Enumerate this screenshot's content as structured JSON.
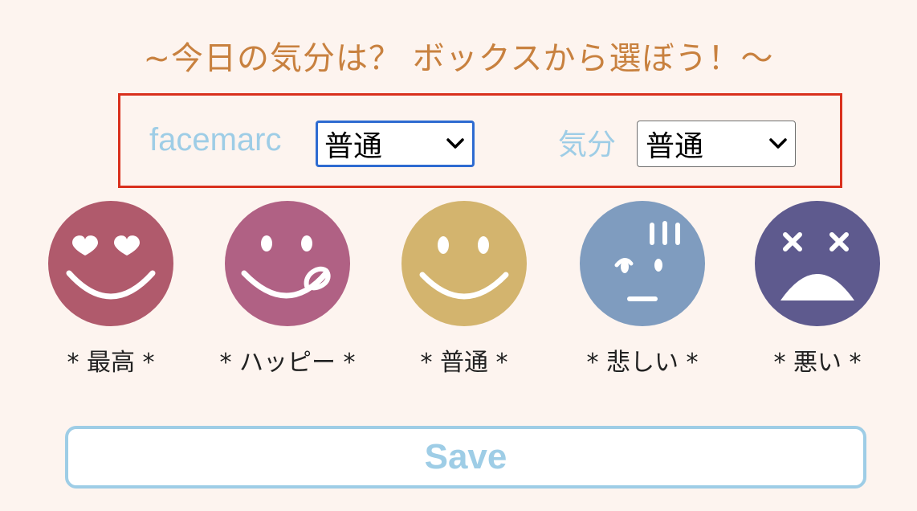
{
  "heading": "~今日の気分は？ ボックスから選ぼう！〜",
  "selector": {
    "facemarc_label": "facemarc",
    "facemarc_value": "普通",
    "mood_label": "気分",
    "mood_value": "普通"
  },
  "faces": [
    {
      "label": "* 最高 *",
      "icon": "heart-eyes-face-icon",
      "color": "#b05a6c"
    },
    {
      "label": "* ハッピー *",
      "icon": "tongue-out-face-icon",
      "color": "#b06184"
    },
    {
      "label": "* 普通 *",
      "icon": "smiling-face-icon",
      "color": "#d3b46e"
    },
    {
      "label": "* 悲しい *",
      "icon": "worried-face-icon",
      "color": "#7f9cbf"
    },
    {
      "label": "* 悪い *",
      "icon": "dizzy-sad-face-icon",
      "color": "#5e5a8e"
    }
  ],
  "save_label": "Save",
  "colors": {
    "background": "#fdf4ef",
    "heading": "#c8813f",
    "accent_blue": "#9ecde6",
    "frame_red": "#d9301d",
    "focus_blue": "#2e6bd1"
  }
}
